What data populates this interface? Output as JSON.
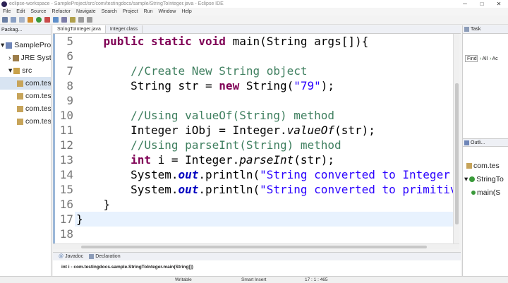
{
  "window": {
    "title": "eclipse-workspace - SampleProject/src/com/testingdocs/sample/StringToInteger.java - Eclipse IDE",
    "controls": [
      "─",
      "□",
      "✕"
    ]
  },
  "menu": [
    "File",
    "Edit",
    "Source",
    "Refactor",
    "Navigate",
    "Search",
    "Project",
    "Run",
    "Window",
    "Help"
  ],
  "package_explorer": {
    "tab_label": "Packag...",
    "items": [
      {
        "label": "SampleProj",
        "prefix": "▾"
      },
      {
        "label": "JRE Syste",
        "prefix": "›"
      },
      {
        "label": "src",
        "prefix": "▾"
      },
      {
        "label": "com.tes",
        "prefix": ""
      },
      {
        "label": "com.tes",
        "prefix": ""
      },
      {
        "label": "com.tes",
        "prefix": ""
      },
      {
        "label": "com.tes",
        "prefix": ""
      }
    ]
  },
  "editor": {
    "tabs": [
      "StringToInteger.java",
      "Integer.class"
    ],
    "line_numbers": [
      "5",
      "6",
      "7",
      "8",
      "9",
      "10",
      "11",
      "12",
      "13",
      "14",
      "15",
      "16",
      "17",
      "18"
    ]
  },
  "bottom_panel": {
    "tabs": [
      "Javadoc",
      "Declaration"
    ],
    "content": "int i - com.testingdocs.sample.StringToInteger.main(String[])"
  },
  "right_panel": {
    "task_tab": "Task",
    "find_label": "Find",
    "find_all": "All",
    "find_act": "Ac",
    "outline_tab": "Outli...",
    "outline_items": [
      "com.tes",
      "StringTo",
      "main(S"
    ]
  },
  "status": {
    "mode": "Writable",
    "insert": "Smart Insert",
    "position": "17 : 1 : 465"
  },
  "colors": {
    "keyword": "#7f0055",
    "comment": "#3f7f5f",
    "string": "#2a00ff",
    "field": "#0000c0"
  }
}
